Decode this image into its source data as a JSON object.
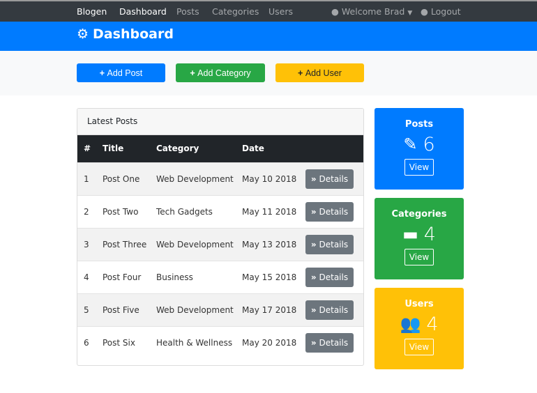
{
  "nav": {
    "brand": "Blogen",
    "links": [
      "Dashboard",
      "Posts",
      "Categories",
      "Users"
    ],
    "user": "Welcome Brad",
    "logout": "Logout"
  },
  "header": {
    "title": "Dashboard"
  },
  "actions": {
    "add_post": "Add Post",
    "add_category": "Add Category",
    "add_user": "Add User"
  },
  "posts_card": {
    "title": "Latest Posts",
    "columns": [
      "#",
      "Title",
      "Category",
      "Date"
    ],
    "rows": [
      {
        "id": "1",
        "title": "Post One",
        "category": "Web Development",
        "date": "May 10 2018"
      },
      {
        "id": "2",
        "title": "Post Two",
        "category": "Tech Gadgets",
        "date": "May 11 2018"
      },
      {
        "id": "3",
        "title": "Post Three",
        "category": "Web Development",
        "date": "May 13 2018"
      },
      {
        "id": "4",
        "title": "Post Four",
        "category": "Business",
        "date": "May 15 2018"
      },
      {
        "id": "5",
        "title": "Post Five",
        "category": "Web Development",
        "date": "May 17 2018"
      },
      {
        "id": "6",
        "title": "Post Six",
        "category": "Health & Wellness",
        "date": "May 20 2018"
      }
    ],
    "details_label": "Details"
  },
  "stats": [
    {
      "title": "Posts",
      "count": "6",
      "view": "View",
      "color": "#007bff"
    },
    {
      "title": "Categories",
      "count": "4",
      "view": "View",
      "color": "#28a745"
    },
    {
      "title": "Users",
      "count": "4",
      "view": "View",
      "color": "#ffc107"
    }
  ]
}
